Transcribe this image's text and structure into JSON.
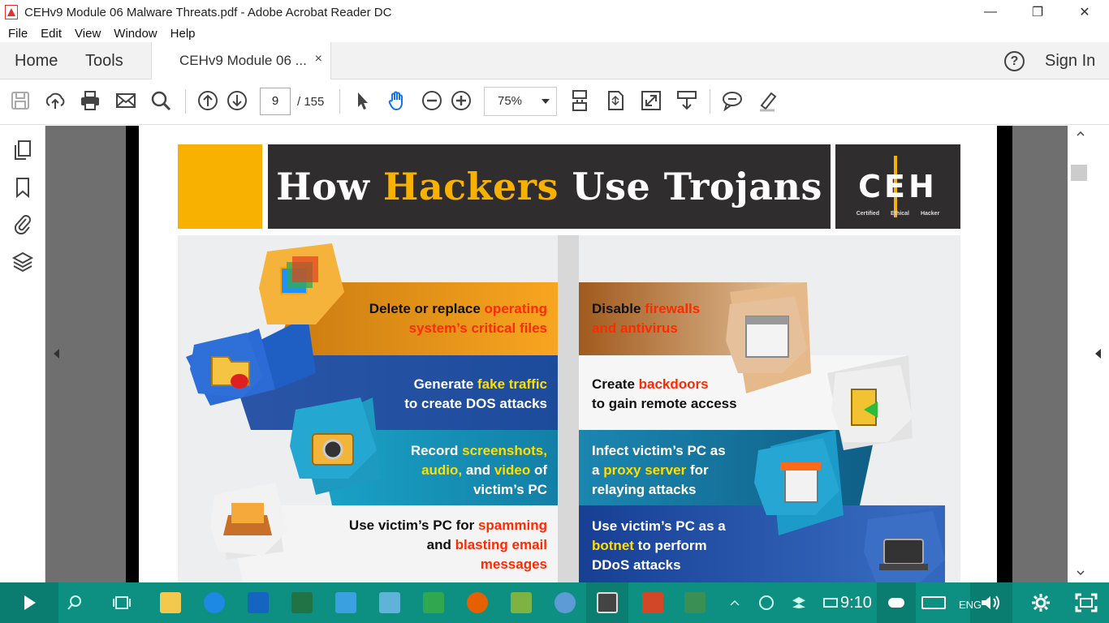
{
  "window": {
    "title": "CEHv9 Module 06 Malware Threats.pdf - Adobe Acrobat Reader DC",
    "minimize": "—",
    "restore": "❐",
    "close": "✕"
  },
  "menu": [
    "File",
    "Edit",
    "View",
    "Window",
    "Help"
  ],
  "tabs": {
    "home": "Home",
    "tools": "Tools",
    "document": "CEHv9 Module 06 ...",
    "close": "×"
  },
  "header": {
    "help": "?",
    "signin": "Sign In"
  },
  "toolbar": {
    "page_current": "9",
    "page_total": "/  155",
    "zoom": "75%",
    "icons": [
      "save-icon",
      "upload-icon",
      "print-icon",
      "email-icon",
      "search-icon",
      "page-up-icon",
      "page-down-icon",
      "select-arrow-icon",
      "hand-icon",
      "zoom-out-icon",
      "zoom-in-icon",
      "scroll-mode-icon",
      "fit-page-icon",
      "full-screen-icon",
      "read-mode-icon",
      "comment-icon",
      "highlight-icon"
    ]
  },
  "sidebar": {
    "icons": [
      "page-thumbnails-icon",
      "bookmark-icon",
      "attachment-icon",
      "layers-icon"
    ]
  },
  "pdf": {
    "title_part1": "How ",
    "title_highlight": "Hackers",
    "title_part2": " Use Trojans",
    "logo_text": "CEH",
    "logo_sub": "Certified Ethical Hacker",
    "left_items": [
      {
        "plain": "Delete or replace ",
        "red": "operating",
        "red2": "system’s critical files"
      },
      {
        "plain": "Generate ",
        "yellow": "fake traffic",
        "plain2": "to create DOS attacks"
      },
      {
        "plain": "Record ",
        "yellow": "screenshots,",
        "yellow2": "audio,",
        "plain2": " and ",
        "yellow3": "video",
        "plain3": " of",
        "plain4": "victim’s PC"
      },
      {
        "plain": "Use victim’s PC for ",
        "red": "spamming",
        "plain2": "and ",
        "red2": "blasting email",
        "red3": "messages"
      }
    ],
    "right_items": [
      {
        "plain": "Disable ",
        "red": "firewalls",
        "red2": "and antivirus"
      },
      {
        "plain": "Create ",
        "red": "backdoors",
        "plain2": "to gain remote access"
      },
      {
        "plain": "Infect victim’s PC as",
        "plain2": "a ",
        "yellow": "proxy server",
        "plain3": " for",
        "plain4": "relaying attacks"
      },
      {
        "plain": "Use victim’s PC as a",
        "yellow": "botnet",
        "plain2": " to perform",
        "plain3": "DDoS attacks"
      }
    ]
  },
  "taskbar": {
    "clock": "9:10",
    "lang": "ENG",
    "apps": [
      "start-button",
      "search-icon",
      "task-view-icon",
      "file-explorer-icon",
      "edge-icon",
      "outlook-icon",
      "excel-icon",
      "store-icon",
      "app-icon",
      "camtasia-icon",
      "firefox-icon",
      "network-app-icon",
      "vpn-icon",
      "acrobat-icon",
      "powerpoint-icon",
      "camtasia-2-icon"
    ]
  },
  "colors": {
    "teal_taskbar": "#0d8f82",
    "banner_dark": "#2f2d2e",
    "accent_yellow": "#f9b100",
    "highlight_red": "#ff2a00",
    "highlight_yellow": "#ffde00"
  }
}
